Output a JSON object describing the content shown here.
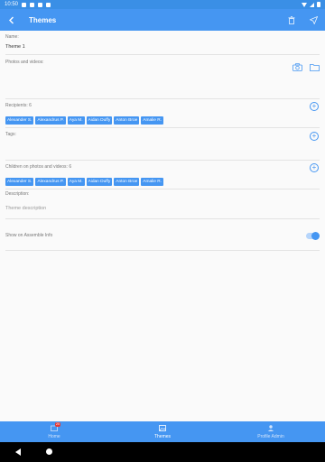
{
  "status_bar": {
    "time": "10:50"
  },
  "app_bar": {
    "title": "Themes"
  },
  "form": {
    "name": {
      "label": "Name:",
      "value": "Theme 1"
    },
    "photos": {
      "label": "Photos and videos:"
    },
    "recipients": {
      "label": "Recipients: 6",
      "chips": [
        "Alexander S.",
        "Alexandrus P.",
        "Aya M.",
        "Aidan Duffy",
        "Anton Broe",
        "Amalie R."
      ]
    },
    "tags": {
      "label": "Tags:"
    },
    "children": {
      "label": "Children on photos and videos: 6",
      "chips": [
        "Alexander S.",
        "Alexandrus P.",
        "Aya M.",
        "Aidan Duffy",
        "Anton Broe",
        "Amalie R."
      ]
    },
    "description": {
      "label": "Description:",
      "placeholder": "Theme description"
    },
    "show_on": {
      "label": "Show on Assemble Info",
      "enabled": true
    }
  },
  "bottom_nav": {
    "items": [
      {
        "label": "Home",
        "badge": "20",
        "icon": "home-icon",
        "active": false
      },
      {
        "label": "Themes",
        "icon": "image-icon",
        "active": true
      },
      {
        "label": "Profile Admin",
        "icon": "person-icon",
        "active": false
      }
    ]
  },
  "colors": {
    "primary": "#4596f2",
    "status_bar": "#3a8fe6",
    "badge": "#e53935"
  }
}
